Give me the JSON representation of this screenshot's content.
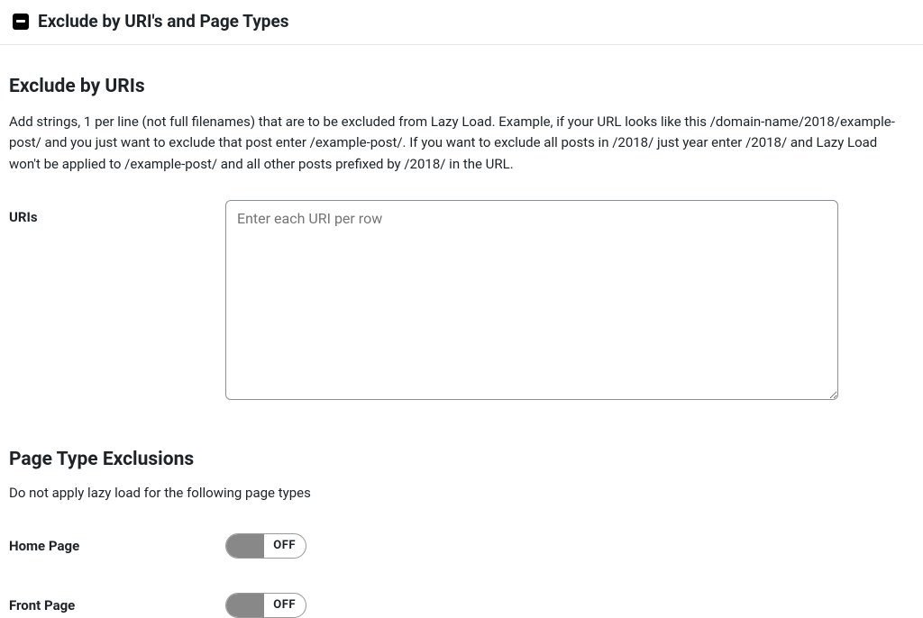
{
  "panel": {
    "title": "Exclude by URI's and Page Types"
  },
  "section_uris": {
    "heading": "Exclude by URIs",
    "description": "Add strings, 1 per line (not full filenames) that are to be excluded from Lazy Load. Example, if your URL looks like this /domain-name/2018/example-post/ and you just want to exclude that post enter /example-post/. If you want to exclude all posts in /2018/ just year enter /2018/ and Lazy Load won't be applied to /example-post/ and all other posts prefixed by /2018/ in the URL.",
    "field_label": "URIs",
    "placeholder": "Enter each URI per row",
    "value": ""
  },
  "section_pagetypes": {
    "heading": "Page Type Exclusions",
    "description": "Do not apply lazy load for the following page types",
    "toggles": {
      "home_page": {
        "label": "Home Page",
        "state": "OFF"
      },
      "front_page": {
        "label": "Front Page",
        "state": "OFF"
      }
    }
  }
}
